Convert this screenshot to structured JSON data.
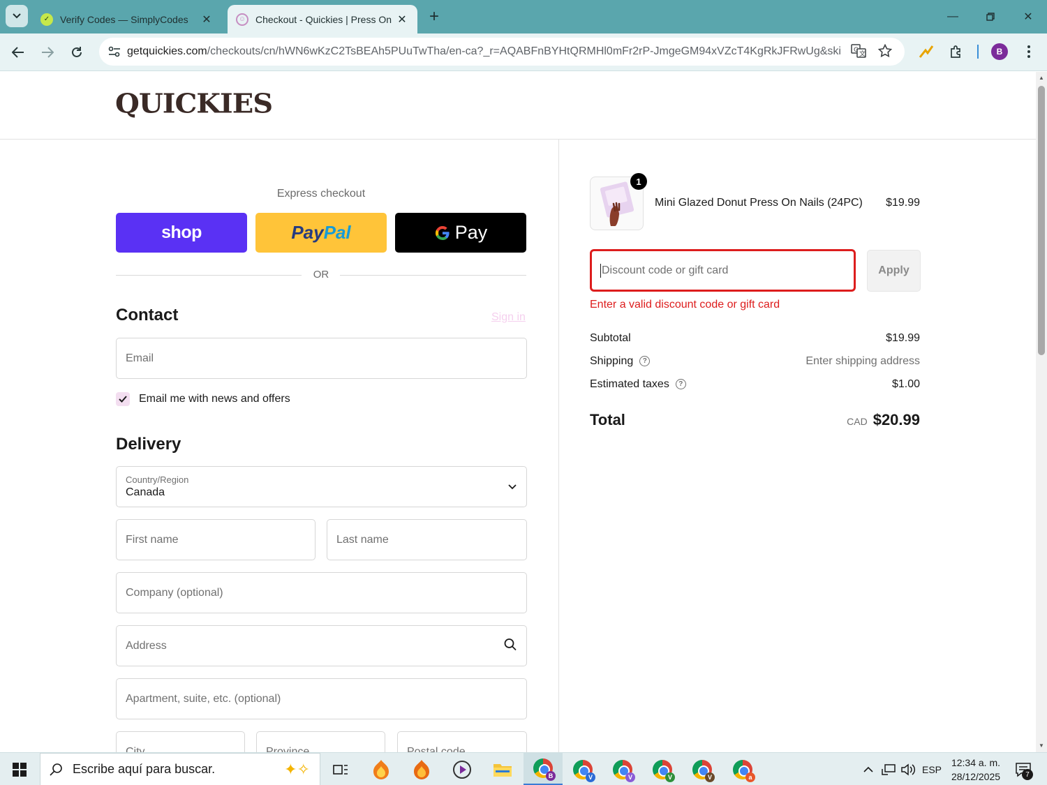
{
  "browser": {
    "tabs": [
      {
        "title": "Verify Codes — SimplyCodes",
        "icon": "simplycodes-icon",
        "active": false
      },
      {
        "title": "Checkout - Quickies | Press On Nails",
        "icon": "quickies-icon",
        "active": true
      }
    ],
    "url_host": "getquickies.com",
    "url_path": "/checkouts/cn/hWN6wKzC2TsBEAh5PUuTwTha/en-ca?_r=AQABFnBYHtQRMHl0mFr2rP-JmgeGM94xVZcT4KgRkJFRwUg&ski...",
    "profile_initial": "B"
  },
  "store": {
    "logo": "QUICKIES"
  },
  "checkout": {
    "express_label": "Express checkout",
    "shop_label": "shop",
    "paypal_pay": "Pay",
    "paypal_pal": "Pal",
    "gpay_label": "Pay",
    "or_label": "OR",
    "contact_title": "Contact",
    "sign_in": "Sign in",
    "email_placeholder": "Email",
    "newsletter_label": "Email me with news and offers",
    "newsletter_checked": true,
    "delivery_title": "Delivery",
    "country_label": "Country/Region",
    "country_value": "Canada",
    "first_name": "First name",
    "last_name": "Last name",
    "company": "Company (optional)",
    "address": "Address",
    "apartment": "Apartment, suite, etc. (optional)",
    "city": "City",
    "province": "Province",
    "postal": "Postal code"
  },
  "summary": {
    "item_qty": "1",
    "item_name": "Mini Glazed Donut Press On Nails (24PC)",
    "item_price": "$19.99",
    "discount_placeholder": "Discount code or gift card",
    "apply_label": "Apply",
    "discount_error": "Enter a valid discount code or gift card",
    "subtotal_label": "Subtotal",
    "subtotal_value": "$19.99",
    "shipping_label": "Shipping",
    "shipping_value": "Enter shipping address",
    "taxes_label": "Estimated taxes",
    "taxes_value": "$1.00",
    "total_label": "Total",
    "total_currency": "CAD",
    "total_value": "$20.99"
  },
  "taskbar": {
    "search_placeholder": "Escribe aquí para buscar.",
    "language": "ESP",
    "time": "12:34 a. m.",
    "date": "28/12/2025",
    "notifications": "7"
  },
  "colors": {
    "shop_purple": "#5a31f4",
    "paypal_yellow": "#ffc439",
    "error_red": "#dd1d1d",
    "tab_strip": "#5aa6ad"
  }
}
